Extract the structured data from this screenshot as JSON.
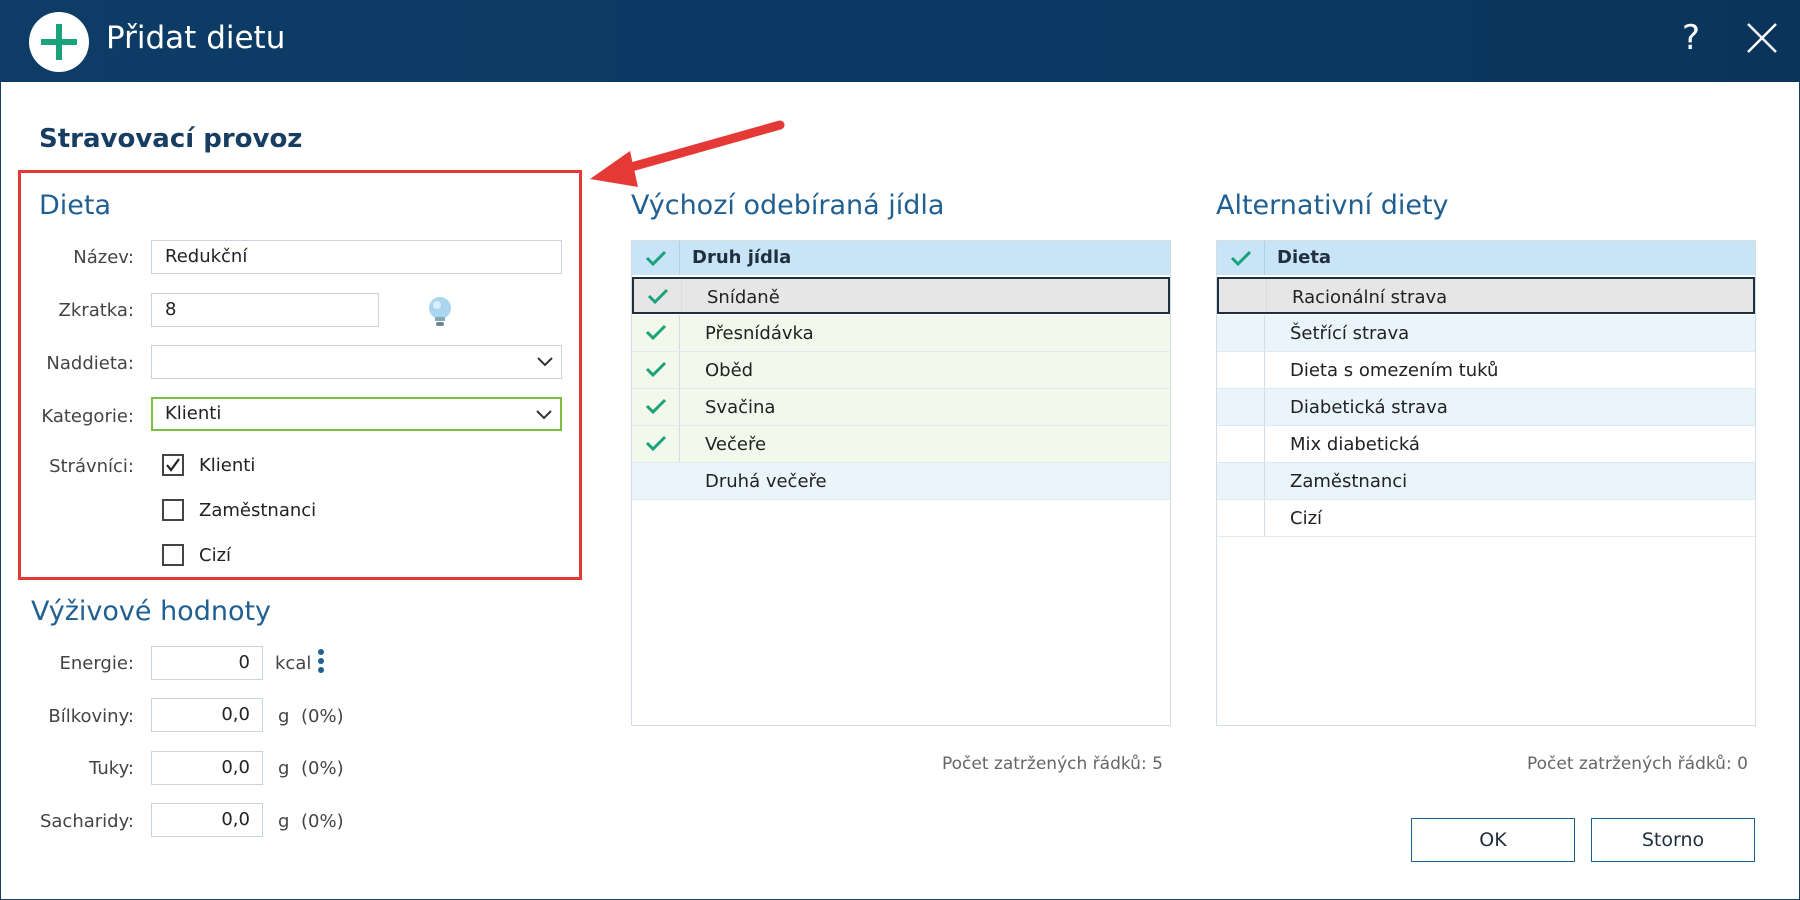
{
  "window": {
    "title": "Přidat dietu",
    "help_label": "?"
  },
  "section_title": "Stravovací provoz",
  "dieta": {
    "heading": "Dieta",
    "nazev_label": "Název:",
    "nazev_value": "Redukční",
    "zkratka_label": "Zkratka:",
    "zkratka_value": "8",
    "naddieta_label": "Naddieta:",
    "naddieta_value": "",
    "kategorie_label": "Kategorie:",
    "kategorie_value": "Klienti",
    "stravnici_label": "Strávníci:",
    "stravnici": [
      {
        "label": "Klienti",
        "checked": true
      },
      {
        "label": "Zaměstnanci",
        "checked": false
      },
      {
        "label": "Cizí",
        "checked": false
      }
    ]
  },
  "nutrition": {
    "heading": "Výživové hodnoty",
    "rows": [
      {
        "label": "Energie:",
        "value": "0",
        "unit": "kcal",
        "pct": ""
      },
      {
        "label": "Bílkoviny:",
        "value": "0,0",
        "unit": "g",
        "pct": "(0%)"
      },
      {
        "label": "Tuky:",
        "value": "0,0",
        "unit": "g",
        "pct": "(0%)"
      },
      {
        "label": "Sacharidy:",
        "value": "0,0",
        "unit": "g",
        "pct": "(0%)"
      }
    ]
  },
  "meals": {
    "heading": "Výchozí odebíraná jídla",
    "column": "Druh jídla",
    "rows": [
      {
        "label": "Snídaně",
        "checked": true,
        "selected": true
      },
      {
        "label": "Přesnídávka",
        "checked": true
      },
      {
        "label": "Oběd",
        "checked": true
      },
      {
        "label": "Svačina",
        "checked": true
      },
      {
        "label": "Večeře",
        "checked": true
      },
      {
        "label": "Druhá večeře",
        "checked": false
      }
    ],
    "count": "Počet zatržených řádků: 5"
  },
  "alt_diets": {
    "heading": "Alternativní diety",
    "column": "Dieta",
    "rows": [
      {
        "label": "Racionální strava",
        "selected": true
      },
      {
        "label": "Šetřící strava"
      },
      {
        "label": "Dieta s omezením tuků"
      },
      {
        "label": "Diabetická strava"
      },
      {
        "label": "Mix diabetická"
      },
      {
        "label": "Zaměstnanci"
      },
      {
        "label": "Cizí"
      }
    ],
    "count": "Počet zatržených řádků: 0"
  },
  "buttons": {
    "ok": "OK",
    "cancel": "Storno"
  },
  "colors": {
    "titlebar": "#0d3d66",
    "accent": "#1f5f91",
    "check": "#1aa37a",
    "highlight": "#e53935"
  }
}
